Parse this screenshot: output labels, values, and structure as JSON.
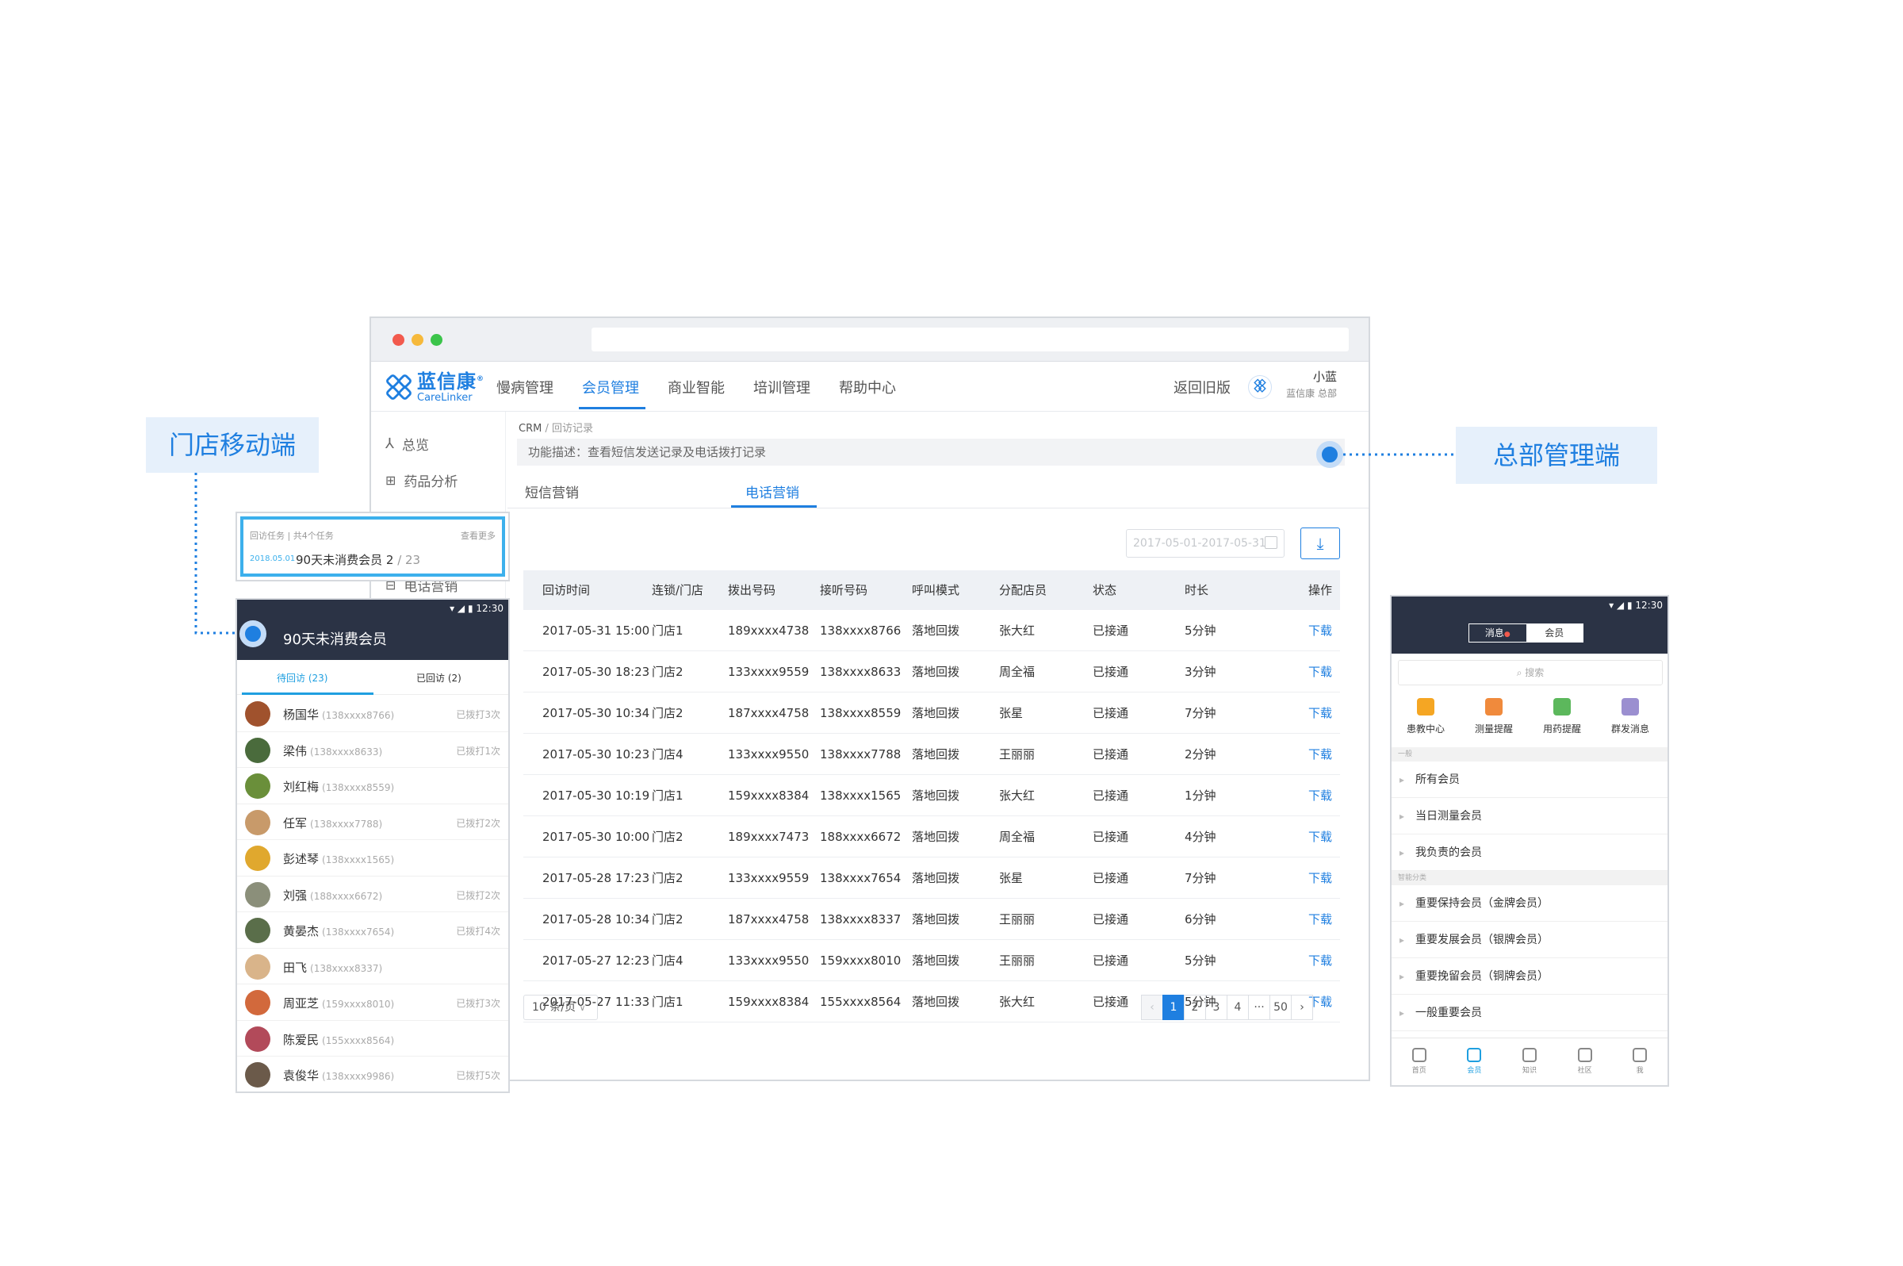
{
  "labels": {
    "store_mobile": "门店移动端",
    "hq_admin": "总部管理端"
  },
  "web": {
    "logo": {
      "cn": "蓝信康",
      "en": "CareLinker",
      "reg": "®"
    },
    "nav": [
      "慢病管理",
      "会员管理",
      "商业智能",
      "培训管理",
      "帮助中心"
    ],
    "nav_active": "会员管理",
    "old_version": "返回旧版",
    "user": {
      "name": "小蓝",
      "org": "蓝信康 总部"
    },
    "sidebar": [
      {
        "label": "总览",
        "icon": "overview-icon"
      },
      {
        "label": "药品分析",
        "icon": "medicine-analysis-icon"
      },
      {
        "label": "电话营销",
        "icon": "phone-marketing-icon"
      }
    ],
    "breadcrumb": {
      "root": "CRM",
      "sep": "/",
      "current": "回访记录"
    },
    "description": "功能描述：查看短信发送记录及电话拨打记录",
    "tabs": [
      "短信营销",
      "电话营销"
    ],
    "tab_active": "电话营销",
    "date_range": "2017-05-01-2017-05-31",
    "download_icon": "download-icon",
    "table": {
      "columns": [
        "回访时间",
        "连锁/门店",
        "拨出号码",
        "接听号码",
        "呼叫模式",
        "分配店员",
        "状态",
        "时长",
        "操作"
      ],
      "rows": [
        [
          "2017-05-31 15:00",
          "门店1",
          "189xxxx4738",
          "138xxxx8766",
          "落地回拨",
          "张大红",
          "已接通",
          "5分钟",
          "下载"
        ],
        [
          "2017-05-30 18:23",
          "门店2",
          "133xxxx9559",
          "138xxxx8633",
          "落地回拨",
          "周全福",
          "已接通",
          "3分钟",
          "下载"
        ],
        [
          "2017-05-30 10:34",
          "门店2",
          "187xxxx4758",
          "138xxxx8559",
          "落地回拨",
          "张星",
          "已接通",
          "7分钟",
          "下载"
        ],
        [
          "2017-05-30 10:23",
          "门店4",
          "133xxxx9550",
          "138xxxx7788",
          "落地回拨",
          "王丽丽",
          "已接通",
          "2分钟",
          "下载"
        ],
        [
          "2017-05-30 10:19",
          "门店1",
          "159xxxx8384",
          "138xxxx1565",
          "落地回拨",
          "张大红",
          "已接通",
          "1分钟",
          "下载"
        ],
        [
          "2017-05-30 10:00",
          "门店2",
          "189xxxx7473",
          "188xxxx6672",
          "落地回拨",
          "周全福",
          "已接通",
          "4分钟",
          "下载"
        ],
        [
          "2017-05-28 17:23",
          "门店2",
          "133xxxx9559",
          "138xxxx7654",
          "落地回拨",
          "张星",
          "已接通",
          "7分钟",
          "下载"
        ],
        [
          "2017-05-28 10:34",
          "门店2",
          "187xxxx4758",
          "138xxxx8337",
          "落地回拨",
          "王丽丽",
          "已接通",
          "6分钟",
          "下载"
        ],
        [
          "2017-05-27 12:23",
          "门店4",
          "133xxxx9550",
          "159xxxx8010",
          "落地回拨",
          "王丽丽",
          "已接通",
          "5分钟",
          "下载"
        ],
        [
          "2017-05-27 11:33",
          "门店1",
          "159xxxx8384",
          "155xxxx8564",
          "落地回拨",
          "张大红",
          "已接通",
          "5分钟",
          "下载"
        ]
      ]
    },
    "page_size": "10 条/页",
    "pagination": {
      "prev": "‹",
      "pages": [
        "1",
        "2",
        "3",
        "4",
        "···",
        "50"
      ],
      "current": "1",
      "next": "›"
    }
  },
  "store_phone": {
    "task_card": {
      "header": "回访任务 | 共4个任务",
      "more": "查看更多",
      "date": "2018.05.01",
      "title": "90天未消费会员 2",
      "count": "/ 23"
    },
    "status_time": "12:30",
    "title": "90天未消费会员",
    "tabs": [
      "待回访 (23)",
      "已回访 (2)"
    ],
    "tab_active": "待回访 (23)",
    "members": [
      {
        "name": "杨国华",
        "phone": "(138xxxx8766)",
        "called": "已拨打3次",
        "color": "#a0522d"
      },
      {
        "name": "梁伟",
        "phone": "(138xxxx8633)",
        "called": "已拨打1次",
        "color": "#4a6b3c"
      },
      {
        "name": "刘红梅",
        "phone": "(138xxxx8559)",
        "called": "",
        "color": "#6a8f3a"
      },
      {
        "name": "任军",
        "phone": "(138xxxx7788)",
        "called": "已拨打2次",
        "color": "#c89a6a"
      },
      {
        "name": "彭述琴",
        "phone": "(138xxxx1565)",
        "called": "",
        "color": "#e0a82e"
      },
      {
        "name": "刘强",
        "phone": "(188xxxx6672)",
        "called": "已拨打2次",
        "color": "#8b8f7a"
      },
      {
        "name": "黄晏杰",
        "phone": "(138xxxx7654)",
        "called": "已拨打4次",
        "color": "#5a6e4a"
      },
      {
        "name": "田飞",
        "phone": "(138xxxx8337)",
        "called": "",
        "color": "#d9b48a"
      },
      {
        "name": "周亚芝",
        "phone": "(159xxxx8010)",
        "called": "已拨打3次",
        "color": "#d2693c"
      },
      {
        "name": "陈爱民",
        "phone": "(155xxxx8564)",
        "called": "",
        "color": "#b24a5a"
      },
      {
        "name": "袁俊华",
        "phone": "(138xxxx9986)",
        "called": "已拨打5次",
        "color": "#6b5a4a"
      }
    ]
  },
  "hq_phone": {
    "status_time": "12:30",
    "segments": [
      "消息",
      "会员"
    ],
    "segment_active": "会员",
    "search_placeholder": "搜索",
    "quick": [
      {
        "label": "患教中心",
        "color": "#f5a623",
        "icon": "education-icon"
      },
      {
        "label": "测量提醒",
        "color": "#f08a3c",
        "icon": "measure-reminder-icon"
      },
      {
        "label": "用药提醒",
        "color": "#5cb85c",
        "icon": "medication-reminder-icon"
      },
      {
        "label": "群发消息",
        "color": "#9b8fd0",
        "icon": "broadcast-icon"
      }
    ],
    "section_general": "一般",
    "general_items": [
      "所有会员",
      "当日测量会员",
      "我负责的会员"
    ],
    "section_smart": "智能分类",
    "smart_items": [
      "重要保持会员（金牌会员）",
      "重要发展会员（银牌会员）",
      "重要挽留会员（铜牌会员）",
      "一般重要会员"
    ],
    "bottom_nav": [
      "首页",
      "会员",
      "知识",
      "社区",
      "我"
    ],
    "bottom_active": "会员"
  }
}
